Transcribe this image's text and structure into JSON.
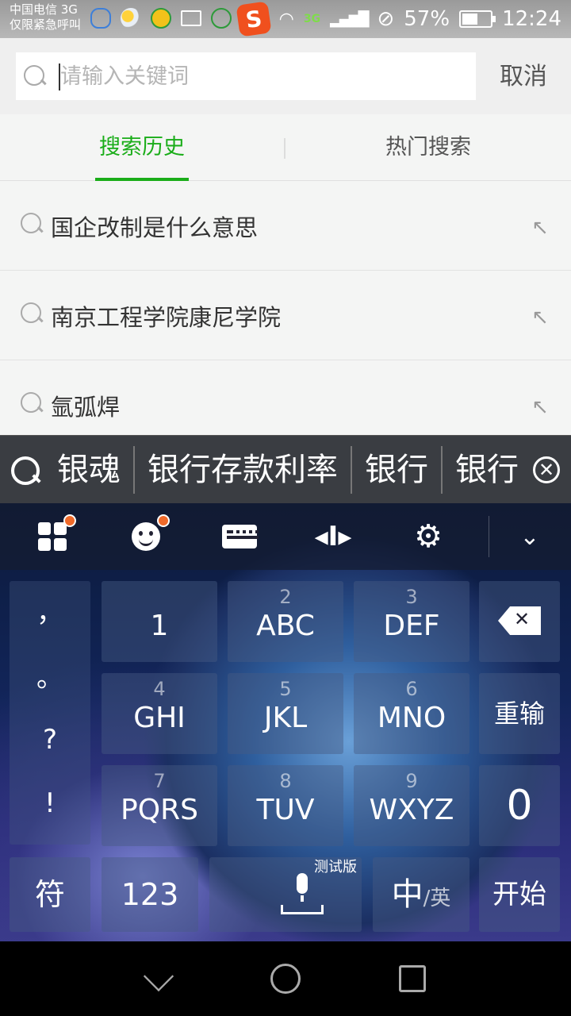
{
  "status_bar": {
    "carrier_line1": "中国电信 3G",
    "carrier_line2": "仅限紧急呼叫",
    "network": "3G",
    "battery": "57%",
    "battery_level": 0.57,
    "time": "12:24",
    "app_badge": "S"
  },
  "search": {
    "placeholder": "请输入关键词",
    "value": "",
    "cancel_label": "取消"
  },
  "tabs": [
    {
      "label": "搜索历史",
      "active": true
    },
    {
      "label": "热门搜索",
      "active": false
    }
  ],
  "history": [
    {
      "text": "国企改制是什么意思"
    },
    {
      "text": "南京工程学院康尼学院"
    },
    {
      "text": "氩弧焊"
    }
  ],
  "candidates": [
    "银魂",
    "银行存款利率",
    "银行",
    "银行"
  ],
  "keyboard": {
    "symbols": [
      "，",
      "。",
      "?",
      "!"
    ],
    "keys": [
      {
        "num": "",
        "label": "1"
      },
      {
        "num": "2",
        "label": "ABC"
      },
      {
        "num": "3",
        "label": "DEF"
      },
      {
        "num": "4",
        "label": "GHI"
      },
      {
        "num": "5",
        "label": "JKL"
      },
      {
        "num": "6",
        "label": "MNO"
      },
      {
        "num": "7",
        "label": "PQRS"
      },
      {
        "num": "8",
        "label": "TUV"
      },
      {
        "num": "9",
        "label": "WXYZ"
      }
    ],
    "reinput": "重输",
    "zero": "0",
    "bottom": {
      "symbols": "符",
      "numbers": "123",
      "beta": "测试版",
      "lang_zh": "中",
      "lang_en": "/英",
      "start": "开始"
    }
  }
}
